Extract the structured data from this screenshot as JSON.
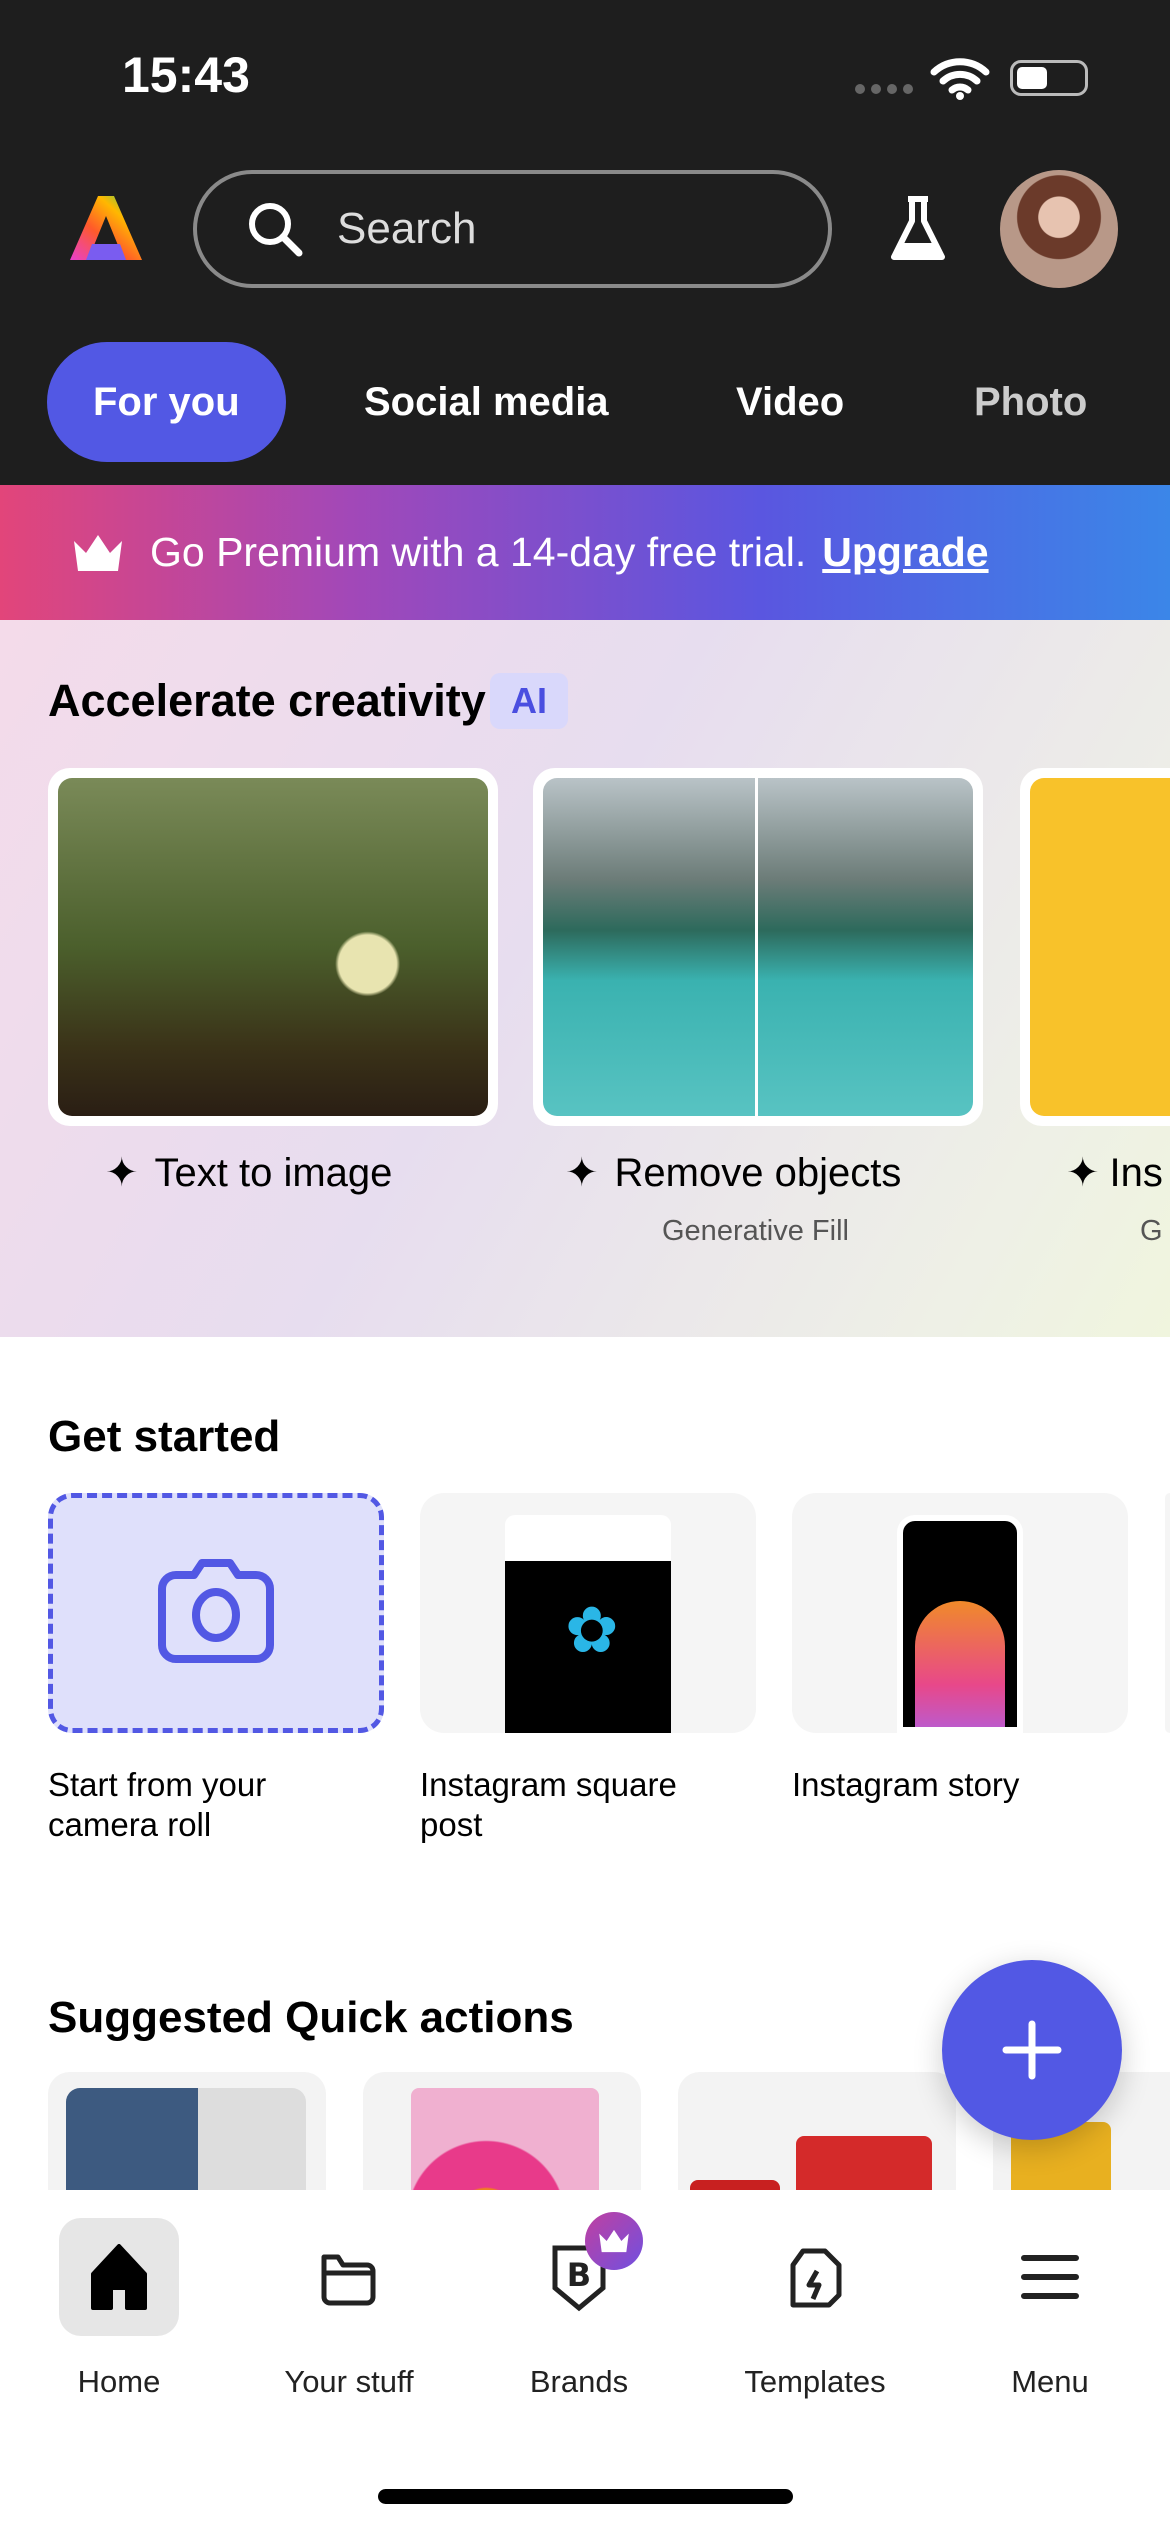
{
  "status_bar": {
    "time": "15:43"
  },
  "header": {
    "search_placeholder": "Search",
    "tabs": [
      {
        "label": "For you",
        "active": true
      },
      {
        "label": "Social media"
      },
      {
        "label": "Video"
      },
      {
        "label": "Photo"
      }
    ]
  },
  "banner": {
    "text": "Go Premium with a 14-day free trial.",
    "link": "Upgrade",
    "icon": "crown-icon"
  },
  "accelerate": {
    "title": "Accelerate creativity",
    "badge": "AI",
    "cards": [
      {
        "label": "Text to image",
        "sub": ""
      },
      {
        "label": "Remove objects",
        "sub": "Generative Fill"
      },
      {
        "label": "Ins",
        "sub": "G"
      }
    ]
  },
  "get_started": {
    "title": "Get started",
    "tiles": [
      {
        "label": "Start from your camera roll"
      },
      {
        "label": "Instagram square post"
      },
      {
        "label": "Instagram story"
      }
    ]
  },
  "quick_actions": {
    "title": "Suggested Quick actions"
  },
  "nav": {
    "items": [
      {
        "label": "Home",
        "active": true
      },
      {
        "label": "Your stuff"
      },
      {
        "label": "Brands"
      },
      {
        "label": "Templates"
      },
      {
        "label": "Menu"
      }
    ]
  },
  "colors": {
    "accent": "#5258e4",
    "header_bg": "#1e1e1e"
  }
}
